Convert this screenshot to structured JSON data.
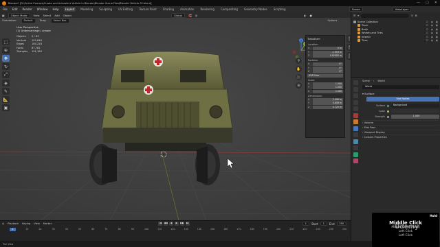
{
  "titlebar": {
    "title": "Blender* [D:\\Online Courses\\Create and Animate a Vehicle in Blender\\Blender Scene Files\\Blender Vehicle 02.blend]",
    "min": "—",
    "max": "▢",
    "close": "✕"
  },
  "menu": {
    "items": [
      "File",
      "Edit",
      "Render",
      "Window",
      "Help"
    ],
    "workspaces": [
      "Layout",
      "Modeling",
      "Sculpting",
      "UV Editing",
      "Texture Paint",
      "Shading",
      "Animation",
      "Rendering",
      "Compositing",
      "Geometry Nodes",
      "Scripting"
    ],
    "active_workspace": "Layout",
    "scene": "Scene",
    "view_layer": "ViewLayer"
  },
  "viewport": {
    "header": {
      "mode": "Object Mode",
      "view": "View",
      "select": "Select",
      "add": "Add",
      "object": "Object",
      "transform": "Global",
      "options": "Options"
    },
    "header2": {
      "orientation_label": "Orientation:",
      "orientation": "Default",
      "drag_label": "Drag:",
      "drag": "Select Box"
    },
    "info": {
      "view": "User Perspective",
      "collection": "(1) Undercarriage | simple",
      "stats": [
        {
          "k": "Objects",
          "v": "0 / 63"
        },
        {
          "k": "Vertices",
          "v": "102,846"
        },
        {
          "k": "Edges",
          "v": "180,228"
        },
        {
          "k": "Faces",
          "v": "87,782"
        },
        {
          "k": "Triangles",
          "v": "191,164"
        }
      ]
    },
    "gizmo": {
      "x": "X",
      "y": "Y",
      "z": "Z"
    }
  },
  "npanel": {
    "title": "Transform",
    "location_label": "Location:",
    "location": [
      {
        "k": "X",
        "v": "0 m"
      },
      {
        "k": "Y",
        "v": "-1.916 m"
      },
      {
        "k": "Z",
        "v": "0.92092 m"
      }
    ],
    "rotation_label": "Rotation:",
    "rotation": [
      {
        "k": "X",
        "v": "0°"
      },
      {
        "k": "Y",
        "v": "0°"
      },
      {
        "k": "Z",
        "v": "0°"
      }
    ],
    "rotation_mode": "XYZ Euler",
    "scale_label": "Scale:",
    "scale": [
      {
        "k": "X",
        "v": "1.000"
      },
      {
        "k": "Y",
        "v": "1.000"
      },
      {
        "k": "Z",
        "v": "1.000"
      }
    ],
    "dimensions_label": "Dimensions:",
    "dimensions": [
      {
        "k": "X",
        "v": "2.496 m"
      },
      {
        "k": "Y",
        "v": "0.608 m"
      },
      {
        "k": "Z",
        "v": "0.725 m"
      }
    ],
    "tabs": [
      "Item",
      "Tool",
      "View"
    ]
  },
  "timeline": {
    "menus": [
      "Playback",
      "Keying",
      "View",
      "Marker"
    ],
    "ruler": [
      "0",
      "10",
      "20",
      "30",
      "40",
      "50",
      "60",
      "70",
      "80",
      "90",
      "100",
      "110",
      "120",
      "130",
      "140",
      "150",
      "160",
      "170",
      "180",
      "190",
      "200",
      "210",
      "220",
      "230",
      "240",
      "250"
    ],
    "current_frame": "1",
    "start_label": "Start",
    "start": "1",
    "end_label": "End",
    "end": "250",
    "play": [
      "|◀",
      "◀◀",
      "◀",
      "▶",
      "▶▶",
      "▶|"
    ]
  },
  "statusbar": {
    "text": "Pan View"
  },
  "outliner": {
    "title": "Scene Collection",
    "search_placeholder": "",
    "items": [
      {
        "name": "Scene Collection",
        "color": "#9a9a9a",
        "indent": 0
      },
      {
        "name": "Truck",
        "color": "#e09a3c",
        "indent": 1
      },
      {
        "name": "Body",
        "color": "#e09a3c",
        "indent": 1
      },
      {
        "name": "Wheels and Tires",
        "color": "#e09a3c",
        "indent": 1
      },
      {
        "name": "Interior",
        "color": "#e09a3c",
        "indent": 1
      },
      {
        "name": "Tires",
        "color": "#e09a3c",
        "indent": 1
      }
    ]
  },
  "properties": {
    "breadcrumb": [
      "Scene",
      "World"
    ],
    "world_name": "World",
    "surface_header": "Surface",
    "use_nodes": "Use Nodes",
    "surface_label": "Surface",
    "surface_value": "Background",
    "color_label": "Color",
    "strength_label": "Strength",
    "strength_value": "1.000",
    "collapsed": [
      "Volume",
      "Mist Pass",
      "Viewport Display",
      "Custom Properties"
    ]
  },
  "screencast": {
    "hold": "Hold",
    "main": "Middle Click",
    "sub": [
      "Middle Click [Hold]",
      "Left Click",
      "Left Click"
    ]
  },
  "watermark": "Udemy"
}
